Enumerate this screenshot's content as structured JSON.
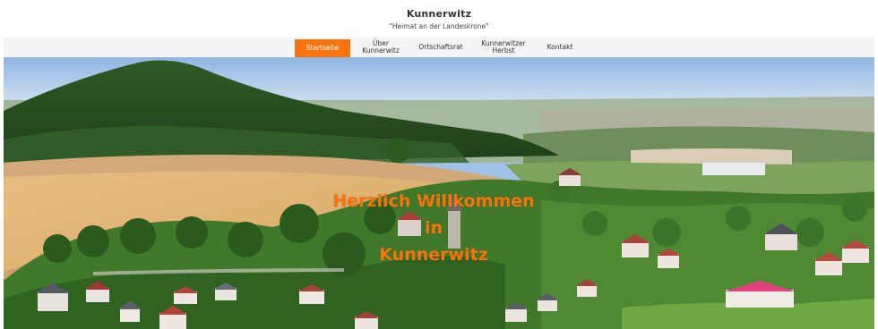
{
  "header": {
    "title": "Kunnerwitz",
    "tagline": "\"Heimat an der Landeskrone\""
  },
  "nav": {
    "items": [
      {
        "label": "Startseite",
        "active": true
      },
      {
        "label": "Über\nKunnerwitz",
        "active": false
      },
      {
        "label": "Ortschaftsrat",
        "active": false
      },
      {
        "label": "Kunnerwitzer\nHerbst",
        "active": false
      },
      {
        "label": "Kontakt",
        "active": false
      }
    ]
  },
  "hero": {
    "line1": "Herzlich Willkommen",
    "line2": "in",
    "line3": "Kunnerwitz"
  },
  "colors": {
    "accent": "#f7740f",
    "nav_background": "#f4f4f4",
    "sky": "#9fc1e6"
  }
}
